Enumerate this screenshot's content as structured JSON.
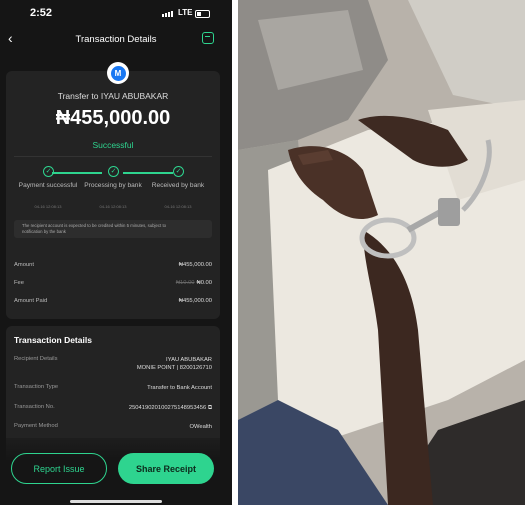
{
  "status_bar": {
    "time": "2:52",
    "network": "LTE"
  },
  "header": {
    "back_icon": "chevron-left-icon",
    "title": "Transaction Details",
    "support_icon": "headset-icon"
  },
  "summary": {
    "bank_logo": "M",
    "recipient_line": "Transfer to IYAU ABUBAKAR",
    "amount": "₦455,000.00",
    "status": "Successful",
    "steps": [
      {
        "label": "Payment successful",
        "date": "04-16 12:08:13"
      },
      {
        "label": "Processing by bank",
        "date": "04-16 12:08:13"
      },
      {
        "label": "Received by bank",
        "date": "04-16 12:08:13"
      }
    ],
    "note": "The recipient account is expected to be credited within 5 minutes, subject to notification by the bank",
    "breakdown": [
      {
        "key": "Amount",
        "value": "₦455,000.00",
        "strike": ""
      },
      {
        "key": "Fee",
        "value": "₦0.00",
        "strike": "₦10.00"
      },
      {
        "key": "Amount Paid",
        "value": "₦455,000.00",
        "strike": ""
      }
    ]
  },
  "details": {
    "heading": "Transaction Details",
    "rows": [
      {
        "key": "Recipient Details",
        "value": "IYAU ABUBAKAR",
        "value2": "MONIE POINT | 8200126710"
      },
      {
        "key": "Transaction Type",
        "value": "Transfer to Bank Account",
        "value2": ""
      },
      {
        "key": "Transaction No.",
        "value": "250419020100275148953456",
        "value2": ""
      },
      {
        "key": "Payment Method",
        "value": "OWealth",
        "value2": ""
      }
    ]
  },
  "actions": {
    "report": "Report Issue",
    "share": "Share Receipt"
  },
  "colors": {
    "accent": "#2ed48f",
    "background": "#151515",
    "card": "#232323"
  }
}
